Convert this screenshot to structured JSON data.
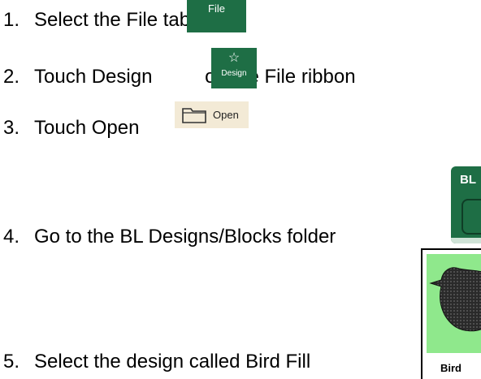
{
  "steps": [
    {
      "number": "1.",
      "text": "Select the File tab"
    },
    {
      "number": "2.",
      "text_before": "Touch Design",
      "text_after": " on the File ribbon"
    },
    {
      "number": "3.",
      "text": "Touch Open"
    },
    {
      "number": "4.",
      "text": "Go to the BL Designs/Blocks folder"
    },
    {
      "number": "5.",
      "text": "Select the design called Bird Fill"
    }
  ],
  "file_tab": {
    "label": "File"
  },
  "design_button": {
    "label": "Design",
    "icon": "star-icon"
  },
  "open_button": {
    "label": "Open",
    "icon": "folder-icon"
  },
  "bl_folder": {
    "label": "BL"
  },
  "bird_thumbnail": {
    "label": "Bird"
  },
  "colors": {
    "ribbon_green": "#1e6e45",
    "open_bg": "#f3ead6",
    "thumb_green": "#8fe88c"
  }
}
